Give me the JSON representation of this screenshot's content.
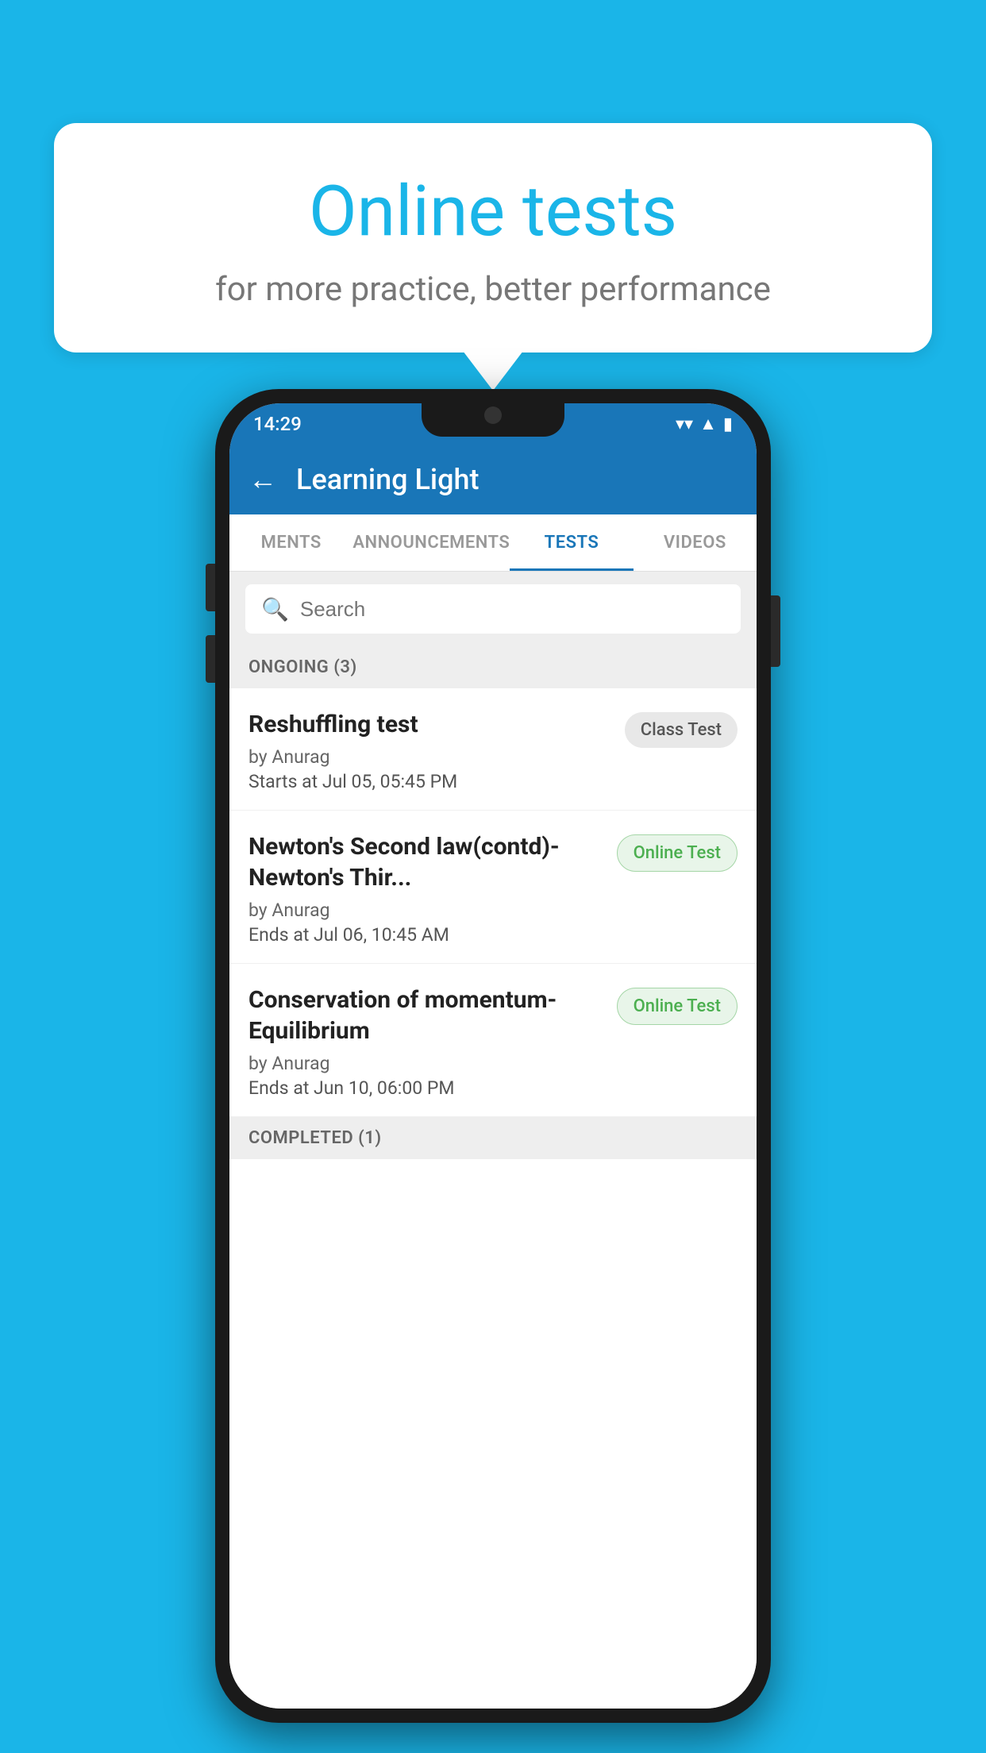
{
  "background_color": "#1ab5e8",
  "speech_bubble": {
    "title": "Online tests",
    "subtitle": "for more practice, better performance"
  },
  "phone": {
    "status_bar": {
      "time": "14:29",
      "wifi": "▼",
      "signal": "▲",
      "battery": "▮"
    },
    "header": {
      "back_label": "←",
      "title": "Learning Light"
    },
    "tabs": [
      {
        "label": "MENTS",
        "active": false
      },
      {
        "label": "ANNOUNCEMENTS",
        "active": false
      },
      {
        "label": "TESTS",
        "active": true
      },
      {
        "label": "VIDEOS",
        "active": false
      }
    ],
    "search": {
      "placeholder": "Search"
    },
    "ongoing_section": {
      "label": "ONGOING (3)"
    },
    "tests": [
      {
        "name": "Reshuffling test",
        "author": "by Anurag",
        "date": "Starts at  Jul 05, 05:45 PM",
        "badge": "Class Test",
        "badge_type": "class"
      },
      {
        "name": "Newton's Second law(contd)-Newton's Thir...",
        "author": "by Anurag",
        "date": "Ends at  Jul 06, 10:45 AM",
        "badge": "Online Test",
        "badge_type": "online"
      },
      {
        "name": "Conservation of momentum-Equilibrium",
        "author": "by Anurag",
        "date": "Ends at  Jun 10, 06:00 PM",
        "badge": "Online Test",
        "badge_type": "online"
      }
    ],
    "completed_section": {
      "label": "COMPLETED (1)"
    }
  }
}
